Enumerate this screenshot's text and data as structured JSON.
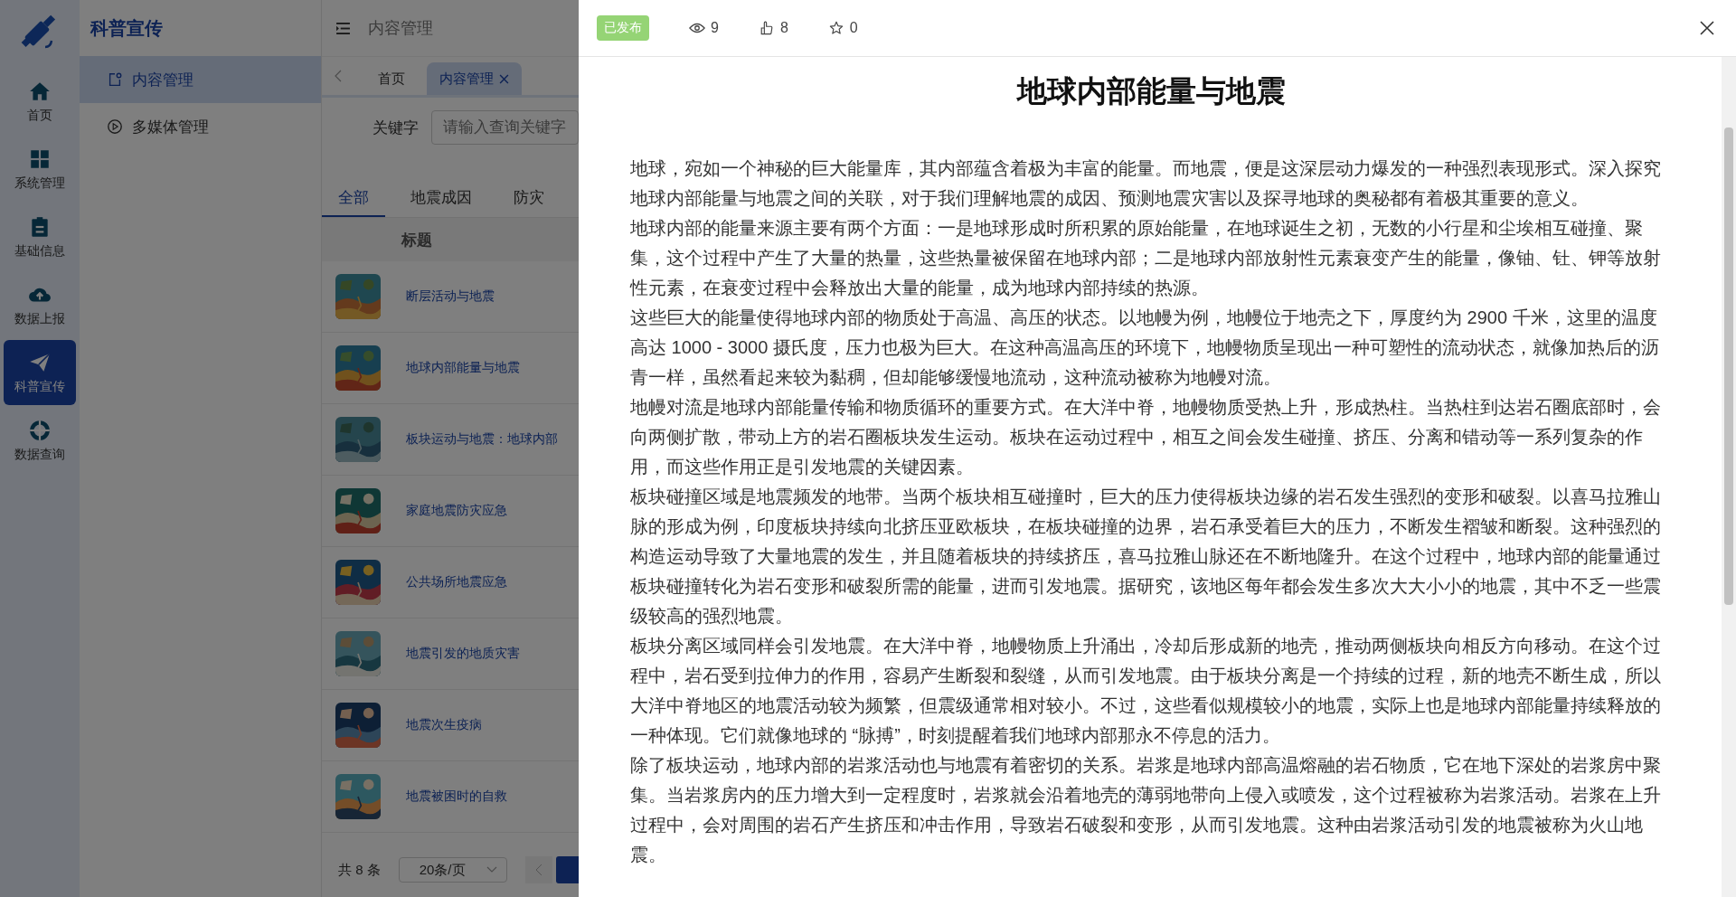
{
  "rail": [
    {
      "label": "首页",
      "selected": false
    },
    {
      "label": "系统管理",
      "selected": false
    },
    {
      "label": "基础信息",
      "selected": false
    },
    {
      "label": "数据上报",
      "selected": false
    },
    {
      "label": "科普宣传",
      "selected": true
    },
    {
      "label": "数据查询",
      "selected": false
    }
  ],
  "submenu": {
    "title": "科普宣传",
    "items": [
      {
        "label": "内容管理",
        "selected": true
      },
      {
        "label": "多媒体管理",
        "selected": false
      }
    ]
  },
  "header": {
    "breadcrumb": "内容管理"
  },
  "page_tabs": [
    {
      "label": "首页",
      "selected": false
    },
    {
      "label": "内容管理",
      "selected": true
    }
  ],
  "search": {
    "label": "关键字",
    "placeholder": "请输入查询关键字"
  },
  "categories": [
    {
      "label": "全部",
      "selected": true
    },
    {
      "label": "地震成因",
      "selected": false
    },
    {
      "label": "防灾",
      "selected": false
    }
  ],
  "table": {
    "columns": [
      "标题"
    ],
    "rows": [
      {
        "title": "断层活动与地震"
      },
      {
        "title": "地球内部能量与地震"
      },
      {
        "title": "板块运动与地震：地球内部"
      },
      {
        "title": "家庭地震防灾应急"
      },
      {
        "title": "公共场所地震应急"
      },
      {
        "title": "地震引发的地质灾害"
      },
      {
        "title": "地震次生疫病"
      },
      {
        "title": "地震被困时的自救"
      }
    ]
  },
  "pagination": {
    "total": "共 8 条",
    "page_size": "20条/页"
  },
  "drawer": {
    "status": "已发布",
    "views": "9",
    "likes": "8",
    "favorites": "0",
    "title": "地球内部能量与地震",
    "paragraphs": [
      "地球，宛如一个神秘的巨大能量库，其内部蕴含着极为丰富的能量。而地震，便是这深层动力爆发的一种强烈表现形式。深入探究地球内部能量与地震之间的关联，对于我们理解地震的成因、预测地震灾害以及探寻地球的奥秘都有着极其重要的意义。",
      "地球内部的能量来源主要有两个方面：一是地球形成时所积累的原始能量，在地球诞生之初，无数的小行星和尘埃相互碰撞、聚集，这个过程中产生了大量的热量，这些热量被保留在地球内部；二是地球内部放射性元素衰变产生的能量，像铀、钍、钾等放射性元素，在衰变过程中会释放出大量的能量，成为地球内部持续的热源。",
      "这些巨大的能量使得地球内部的物质处于高温、高压的状态。以地幔为例，地幔位于地壳之下，厚度约为 2900 千米，这里的温度高达 1000 - 3000 摄氏度，压力也极为巨大。在这种高温高压的环境下，地幔物质呈现出一种可塑性的流动状态，就像加热后的沥青一样，虽然看起来较为黏稠，但却能够缓慢地流动，这种流动被称为地幔对流。",
      "地幔对流是地球内部能量传输和物质循环的重要方式。在大洋中脊，地幔物质受热上升，形成热柱。当热柱到达岩石圈底部时，会向两侧扩散，带动上方的岩石圈板块发生运动。板块在运动过程中，相互之间会发生碰撞、挤压、分离和错动等一系列复杂的作用，而这些作用正是引发地震的关键因素。",
      "板块碰撞区域是地震频发的地带。当两个板块相互碰撞时，巨大的压力使得板块边缘的岩石发生强烈的变形和破裂。以喜马拉雅山脉的形成为例，印度板块持续向北挤压亚欧板块，在板块碰撞的边界，岩石承受着巨大的压力，不断发生褶皱和断裂。这种强烈的构造运动导致了大量地震的发生，并且随着板块的持续挤压，喜马拉雅山脉还在不断地隆升。在这个过程中，地球内部的能量通过板块碰撞转化为岩石变形和破裂所需的能量，进而引发地震。据研究，该地区每年都会发生多次大大小小的地震，其中不乏一些震级较高的强烈地震。",
      "板块分离区域同样会引发地震。在大洋中脊，地幔物质上升涌出，冷却后形成新的地壳，推动两侧板块向相反方向移动。在这个过程中，岩石受到拉伸力的作用，容易产生断裂和裂缝，从而引发地震。由于板块分离是一个持续的过程，新的地壳不断生成，所以大洋中脊地区的地震活动较为频繁，但震级通常相对较小。不过，这些看似规模较小的地震，实际上也是地球内部能量持续释放的一种体现。它们就像地球的 “脉搏”，时刻提醒着我们地球内部那永不停息的活力。",
      "除了板块运动，地球内部的岩浆活动也与地震有着密切的关系。岩浆是地球内部高温熔融的岩石物质，它在地下深处的岩浆房中聚集。当岩浆房内的压力增大到一定程度时，岩浆就会沿着地壳的薄弱地带向上侵入或喷发，这个过程被称为岩浆活动。岩浆在上升过程中，会对周围的岩石产生挤压和冲击作用，导致岩石破裂和变形，从而引发地震。这种由岩浆活动引发的地震被称为火山地震。"
    ]
  }
}
